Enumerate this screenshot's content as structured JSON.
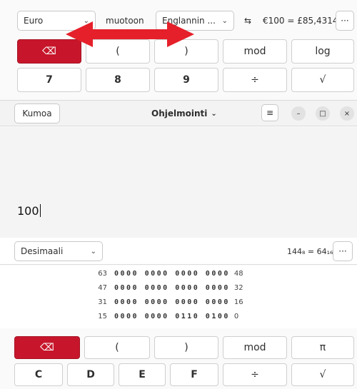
{
  "top_calc": {
    "currency_from": "Euro",
    "to_label": "muotoon",
    "currency_to": "Englannin ...",
    "swap_symbol": "⇆",
    "rate": "€100 = £85,4314",
    "more": "···",
    "keys_row1": [
      "⌫",
      "(",
      ")",
      "mod",
      "log"
    ],
    "keys_row2": [
      "7",
      "8",
      "9",
      "÷",
      "√"
    ]
  },
  "window": {
    "undo_label": "Kumoa",
    "mode_label": "Ohjelmointi",
    "menu_icon": "≡",
    "minimize": "–",
    "maximize": "□",
    "close": "×"
  },
  "display": {
    "input": "100"
  },
  "programming": {
    "base_select": "Desimaali",
    "conversion": "144₈ = 64₁₆",
    "more": "···",
    "bit_rows": [
      {
        "start": "63",
        "bits": "0000 0000 0000 0000",
        "end": "48"
      },
      {
        "start": "47",
        "bits": "0000 0000 0000 0000",
        "end": "32"
      },
      {
        "start": "31",
        "bits": "0000 0000 0000 0000",
        "end": "16"
      },
      {
        "start": "15",
        "bits": "0000 0000 0110 0100",
        "end": "0"
      }
    ]
  },
  "keypad": {
    "row1": [
      "⌫",
      "(",
      ")",
      "mod",
      "π"
    ],
    "row2": [
      "C",
      "D",
      "E",
      "F",
      "÷",
      "√"
    ]
  },
  "colors": {
    "accent": "#c7162b",
    "arrow": "#e5202a"
  }
}
